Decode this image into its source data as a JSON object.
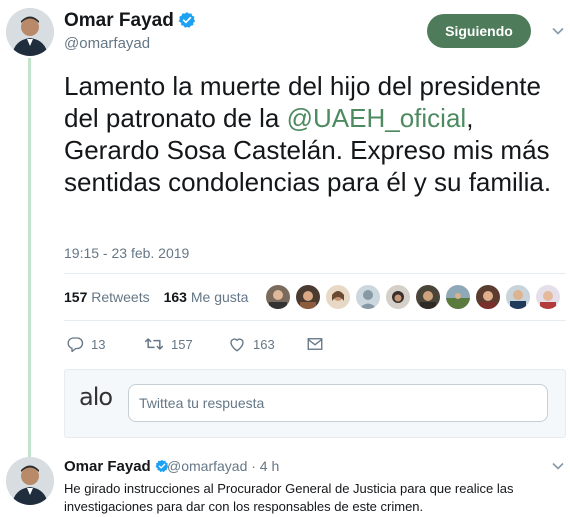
{
  "tweet": {
    "author_name": "Omar Fayad",
    "author_handle": "@omarfayad",
    "follow_label": "Siguiendo",
    "text_before": "Lamento la muerte del hijo del presidente del patronato de la ",
    "mention": "@UAEH_oficial",
    "text_after": ", Gerardo Sosa Castelán. Expreso mis más sentidas condolencias para él y su familia.",
    "timestamp": "19:15 - 23 feb. 2019",
    "retweets_count": "157",
    "retweets_label": "Retweets",
    "likes_count": "163",
    "likes_label": "Me gusta",
    "actions": {
      "reply_count": "13",
      "retweet_count": "157",
      "like_count": "163"
    }
  },
  "reply_box": {
    "logo_text": "alo",
    "placeholder": "Twittea tu respuesta"
  },
  "second_tweet": {
    "author_name": "Omar Fayad",
    "meta": "@omarfayad · 4 h",
    "text": "He girado instrucciones al Procurador General de Justicia para que realice las investigaciones para dar con los responsables de este crimen."
  },
  "colors": {
    "accent": "#4e7c5a",
    "mention": "#4e8a5f",
    "thread_line": "#c4e3cc",
    "verified": "#1da1f2",
    "muted": "#657786"
  },
  "icons": [
    "verified-badge-icon",
    "chevron-down-icon",
    "reply-icon",
    "retweet-icon",
    "heart-icon",
    "envelope-icon"
  ]
}
